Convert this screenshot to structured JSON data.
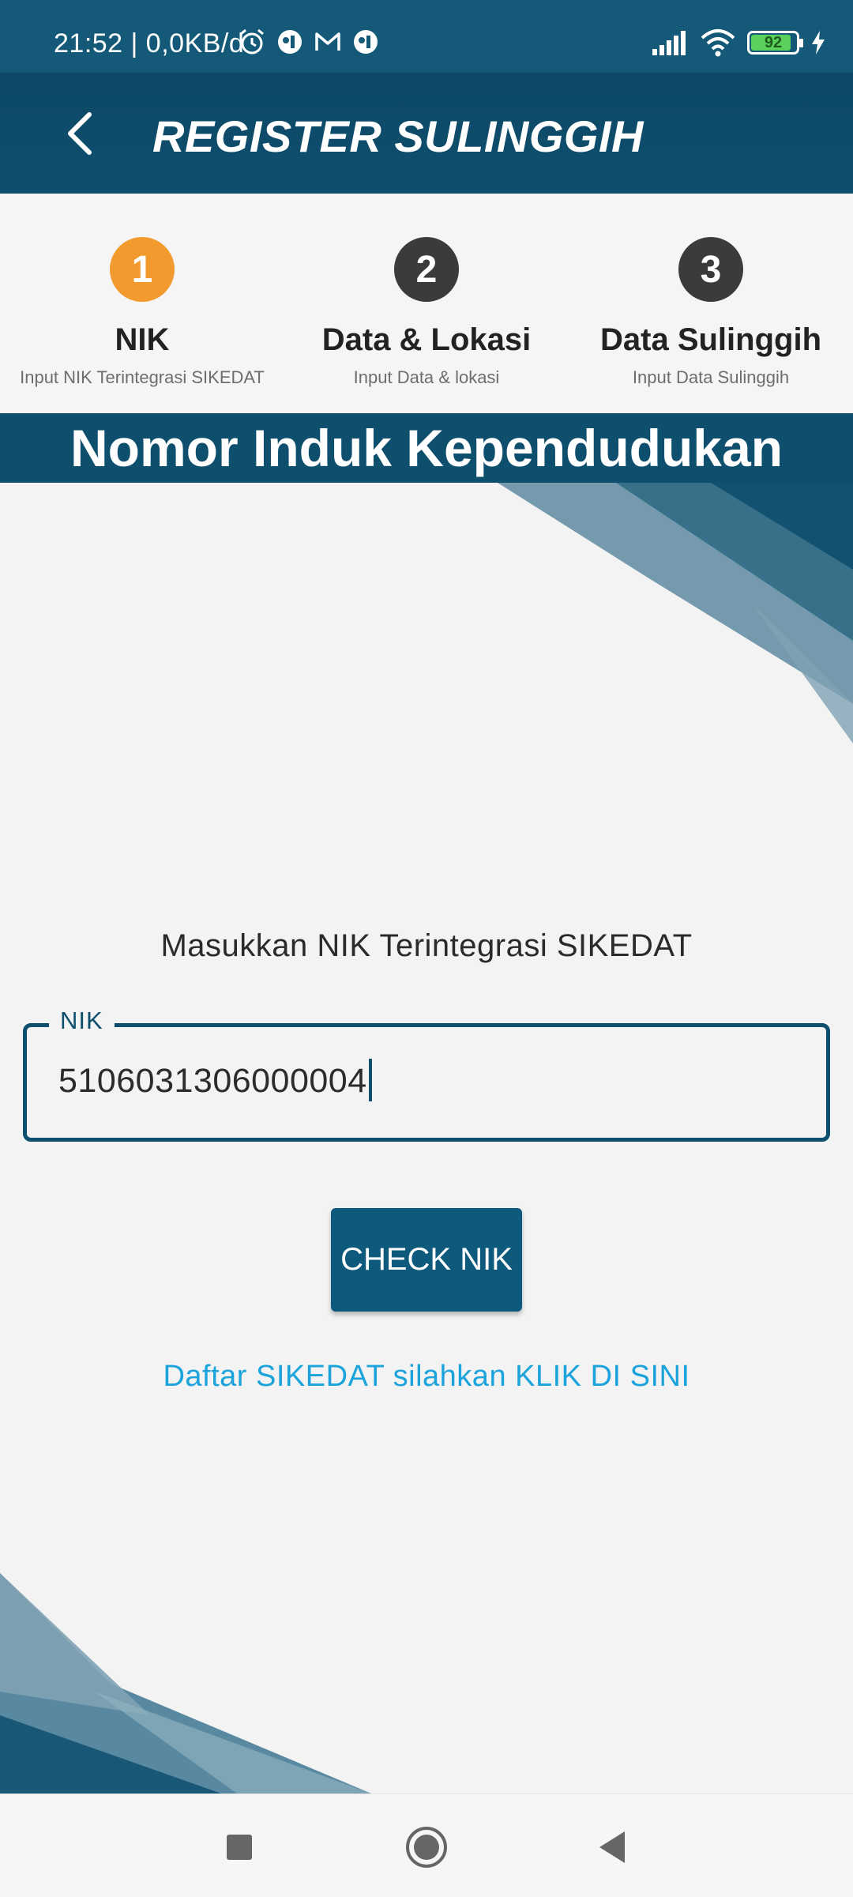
{
  "status_bar": {
    "time_speed": "21:52 | 0,0KB/d",
    "battery": "92",
    "icons": [
      "alarm-icon",
      "app-notification-icon",
      "gmail-icon",
      "app-notification-icon",
      "signal-icon",
      "wifi-icon",
      "battery-icon",
      "charging-icon"
    ]
  },
  "app_bar": {
    "title": "REGISTER SULINGGIH",
    "back_icon": "back-arrow-icon"
  },
  "stepper": {
    "steps": [
      {
        "number": "1",
        "title": "NIK",
        "subtitle": "Input NIK Terintegrasi SIKEDAT",
        "active": true,
        "color": "#f29a2e"
      },
      {
        "number": "2",
        "title": "Data & Lokasi",
        "subtitle": "Input Data & lokasi",
        "active": false,
        "color": "#3b3b3b"
      },
      {
        "number": "3",
        "title": "Data Sulinggih",
        "subtitle": "Input Data Sulinggih",
        "active": false,
        "color": "#3b3b3b"
      }
    ]
  },
  "section": {
    "title": "Nomor Induk Kependudukan"
  },
  "form": {
    "instruction": "Masukkan NIK Terintegrasi SIKEDAT",
    "nik_label": "NIK",
    "nik_value": "5106031306000004",
    "check_button": "CHECK NIK",
    "register_link": "Daftar SIKEDAT silahkan KLIK DI SINI"
  },
  "colors": {
    "primary": "#0e4f6e",
    "accent": "#f29a2e",
    "link": "#1ba3dc"
  },
  "nav_bar": {
    "icons": [
      "recent-apps-icon",
      "home-icon",
      "back-icon"
    ]
  }
}
